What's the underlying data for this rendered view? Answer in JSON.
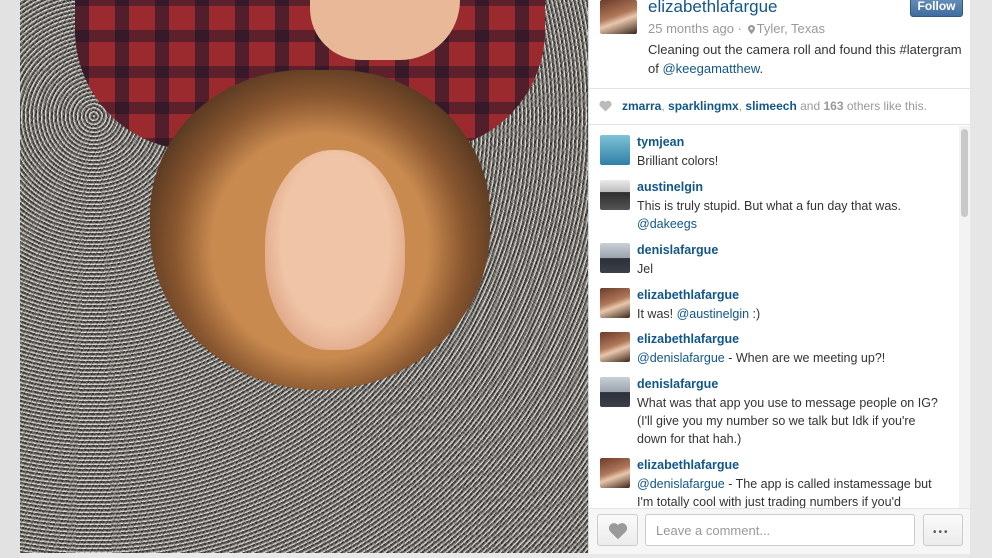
{
  "post": {
    "username": "elizabethlafargue",
    "follow_label": "Follow",
    "time_ago": "25 months ago",
    "separator": "·",
    "location": "Tyler, Texas",
    "caption_text": "Cleaning out the camera roll and found this #latergram of ",
    "caption_mention": "@keegamatthew",
    "caption_end": "."
  },
  "likes": {
    "user1": "zmarra",
    "user2": "sparklingmx",
    "user3": "slimeech",
    "and": "and",
    "count": "163",
    "others": "others like this."
  },
  "comments": [
    {
      "user": "tymjean",
      "text": "Brilliant colors!",
      "mention": "",
      "rest": ""
    },
    {
      "user": "austinelgin",
      "text": "This is truly stupid. But what a fun day that was.",
      "mention": "@dakeegs",
      "rest": ""
    },
    {
      "user": "denislafargue",
      "text": "Jel",
      "mention": "",
      "rest": ""
    },
    {
      "user": "elizabethlafargue",
      "text": "It was! ",
      "mention": "@austinelgin",
      "rest": " :)"
    },
    {
      "user": "elizabethlafargue",
      "text": "",
      "mention": "@denislafargue",
      "rest": " - When are we meeting up?!"
    },
    {
      "user": "denislafargue",
      "text": "What was that app you use to message people on IG? (I'll give you my number so we talk but Idk if you're down for that hah.)",
      "mention": "",
      "rest": ""
    },
    {
      "user": "elizabethlafargue",
      "text": "",
      "mention": "@denislafargue",
      "rest": " - The app is called instamessage but I'm totally cool with just trading numbers if you'd"
    }
  ],
  "footer": {
    "comment_placeholder": "Leave a comment...",
    "more_label": "•••"
  },
  "colors": {
    "link": "#125688",
    "follow_button": "#3f6d9e",
    "muted_text": "#999999"
  },
  "icons": {
    "like": "heart-icon",
    "location": "map-pin-icon",
    "more": "ellipsis-icon"
  }
}
